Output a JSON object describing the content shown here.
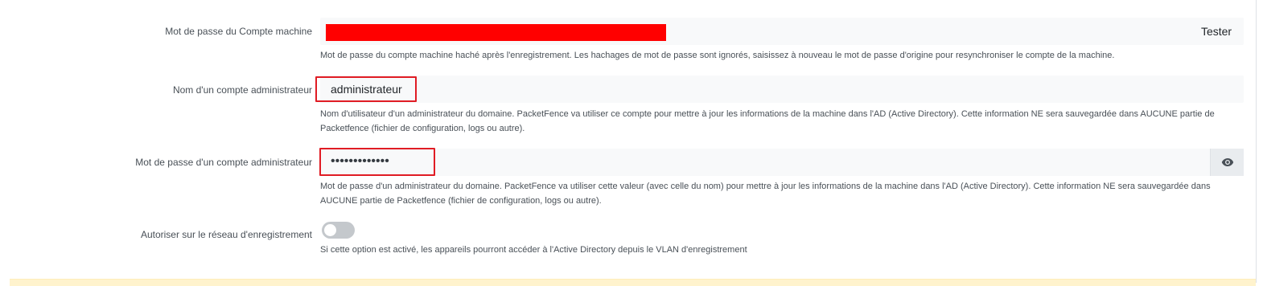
{
  "top_help_fragment": "...r le mot de passe d'origine pour resynchroniser le compte de la machine. (...)",
  "machine_password": {
    "label": "Mot de passe du Compte machine",
    "test_button": "Tester",
    "help": "Mot de passe du compte machine haché après l'enregistrement. Les hachages de mot de passe sont ignorés, saisissez à nouveau le mot de passe d'origine pour resynchroniser le compte de la machine."
  },
  "admin_username": {
    "label": "Nom d'un compte administrateur",
    "value": "administrateur",
    "help": "Nom d'utilisateur d'un administrateur du domaine. PacketFence va utiliser ce compte pour mettre à jour les informations de la machine dans l'AD (Active Directory). Cette information NE sera sauvegardée dans AUCUNE partie de Packetfence (fichier de configuration, logs ou autre)."
  },
  "admin_password": {
    "label": "Mot de passe d'un compte administrateur",
    "value_masked": "•••••••••••••",
    "toggle_icon": "eye-icon",
    "help": "Mot de passe d'un administrateur du domaine. PacketFence va utiliser cette valeur (avec celle du nom) pour mettre à jour les informations de la machine dans l'AD (Active Directory). Cette information NE sera sauvegardée dans AUCUNE partie de Packetfence (fichier de configuration, logs ou autre)."
  },
  "registration_network": {
    "label": "Autoriser sur le réseau d'enregistrement",
    "enabled": false,
    "help": "Si cette option est activé, les appareils pourront accéder à l'Active Directory depuis le VLAN d'enregistrement"
  },
  "colors": {
    "highlight": "#e01c24",
    "redaction": "#ff0000",
    "field_bg": "#f8f9fa",
    "switch_off": "#c4c8cc"
  }
}
